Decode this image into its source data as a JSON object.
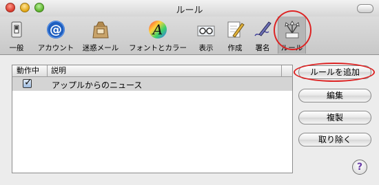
{
  "window": {
    "title": "ルール"
  },
  "toolbar": {
    "items": [
      {
        "label": "一般",
        "icon": "switch-icon"
      },
      {
        "label": "アカウント",
        "icon": "at-sign-icon"
      },
      {
        "label": "迷惑メール",
        "icon": "junk-mail-bag-icon"
      },
      {
        "label": "フォントとカラー",
        "icon": "font-colors-icon"
      },
      {
        "label": "表示",
        "icon": "viewing-glasses-icon"
      },
      {
        "label": "作成",
        "icon": "compose-pencil-icon"
      },
      {
        "label": "署名",
        "icon": "signature-pen-icon"
      },
      {
        "label": "ルール",
        "icon": "rules-icon"
      }
    ],
    "selected": "ルール"
  },
  "table": {
    "columns": [
      "動作中",
      "説明"
    ],
    "rows": [
      {
        "active": true,
        "description": "アップルからのニュース"
      }
    ]
  },
  "buttons": {
    "add_rule": "ルールを追加",
    "edit": "編集",
    "duplicate": "複製",
    "remove": "取り除く"
  },
  "help": {
    "label": "?"
  },
  "colors": {
    "annotation": "#dd2222",
    "selected_row": "#d4d4d4"
  }
}
